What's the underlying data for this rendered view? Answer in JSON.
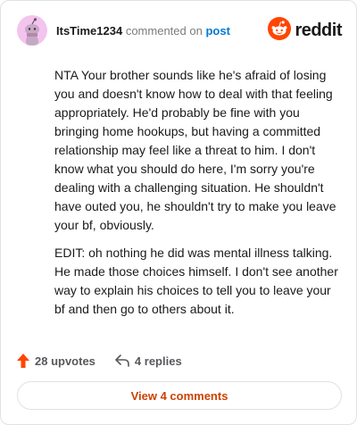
{
  "comment": {
    "username": "ItsTime1234",
    "action_text": "commented on",
    "target_link": "post",
    "brand": "reddit",
    "paragraphs": [
      "NTA Your brother sounds like he's afraid of losing you and doesn't know how to deal with that feeling appropriately. He'd probably be fine with you bringing home hookups, but having a committed relationship may feel like a threat to him. I don't know what you should do here, I'm sorry you're dealing with a challenging situation. He shouldn't have outed you, he shouldn't try to make you leave your bf, obviously.",
      "EDIT: oh nothing he did was mental illness talking. He made those choices himself. I don't see another way to explain his choices to tell you to leave your bf and then go to others about it."
    ]
  },
  "footer": {
    "upvotes_label": "28 upvotes",
    "replies_label": "4 replies",
    "view_comments_label": "View 4 comments"
  },
  "icons": {
    "avatar": "snoo-avatar-icon",
    "brand": "reddit-logo-icon",
    "upvote": "upvote-arrow-icon",
    "reply": "reply-arrow-icon"
  },
  "colors": {
    "brand_orange": "#ff4500",
    "upvote_orange": "#ff4500",
    "link_blue": "#0079d3",
    "view_button_text": "#cc4200",
    "avatar_bg": "#f3c4ee"
  }
}
